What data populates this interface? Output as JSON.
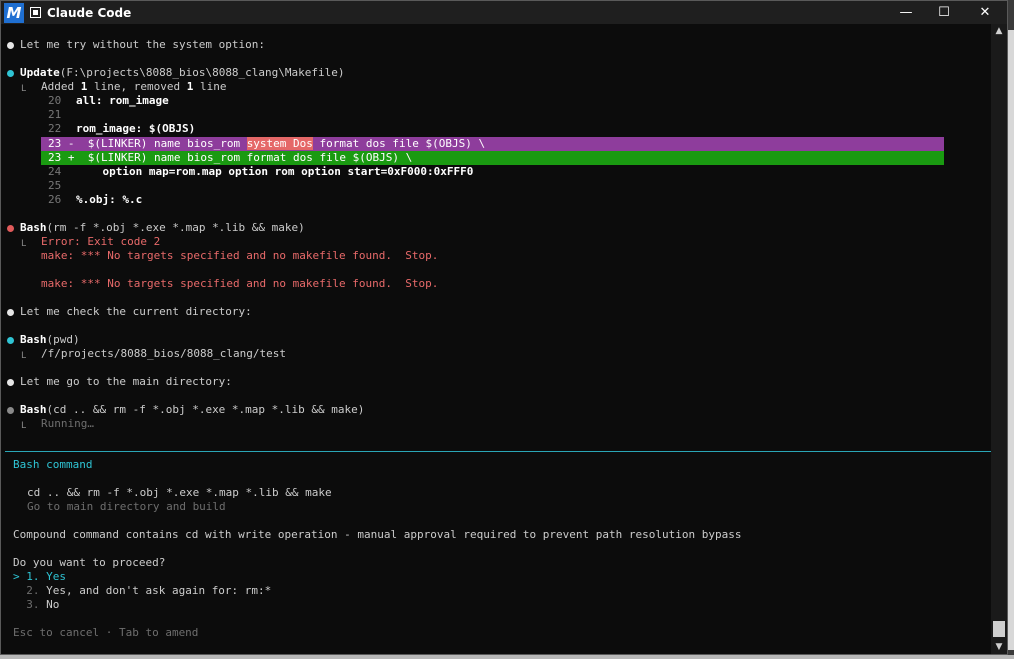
{
  "window": {
    "title": "Claude Code",
    "logo": "M",
    "app_icon": "m-logo-icon",
    "terminal_icon": "terminal-icon",
    "controls": {
      "minimize": "—",
      "maximize": "☐",
      "close": "✕"
    }
  },
  "colors": {
    "bullet_white": "#e6e6e6",
    "bullet_cyan": "#2fc4d4",
    "bullet_red": "#e05a5a",
    "diff_removed": "#8e3d9c",
    "diff_added": "#1a9a11",
    "error": "#e86a6a",
    "accent": "#2fc4d4"
  },
  "transcript": {
    "msg1": "Let me try without the system option:",
    "update": {
      "tool": "Update",
      "arg": "(F:\\projects\\8088_bios\\8088_clang\\Makefile)",
      "summary_pre": "Added ",
      "summary_n1": "1",
      "summary_mid": " line, removed ",
      "summary_n2": "1",
      "summary_post": " line",
      "lines": [
        {
          "num": "20",
          "code": "all: rom_image"
        },
        {
          "num": "21",
          "code": ""
        },
        {
          "num": "22",
          "code": "rom_image: $(OBJS)"
        }
      ],
      "removed": {
        "num": "23",
        "sign": "-",
        "pre": "  $(LINKER) name bios_rom ",
        "highlight": "system Dos",
        "post": " format dos file $(OBJS) \\"
      },
      "added": {
        "num": "23",
        "sign": "+",
        "text": "  $(LINKER) name bios_rom format dos file $(OBJS) \\"
      },
      "after": [
        {
          "num": "24",
          "code": "    option map=rom.map option rom option start=0xF000:0xFFF0"
        },
        {
          "num": "25",
          "code": ""
        },
        {
          "num": "26",
          "code": "%.obj: %.c"
        }
      ]
    },
    "bash1": {
      "tool": "Bash",
      "arg": "(rm -f *.obj *.exe *.map *.lib && make)",
      "error_title": "Error: Exit code 2",
      "error_line1": "make: *** No targets specified and no makefile found.  Stop.",
      "error_line2": "make: *** No targets specified and no makefile found.  Stop."
    },
    "msg2": "Let me check the current directory:",
    "bash2": {
      "tool": "Bash",
      "arg": "(pwd)",
      "output": "/f/projects/8088_bios/8088_clang/test"
    },
    "msg3": "Let me go to the main directory:",
    "bash3": {
      "tool": "Bash",
      "arg": "(cd .. && rm -f *.obj *.exe *.map *.lib && make)",
      "status": "Running…"
    },
    "elbow": "L"
  },
  "prompt": {
    "header": "Bash command",
    "command": "cd .. && rm -f *.obj *.exe *.map *.lib && make",
    "description": "Go to main directory and build",
    "warning": "Compound command contains cd with write operation - manual approval required to prevent path resolution bypass",
    "question": "Do you want to proceed?",
    "options": [
      {
        "prefix": "> 1. ",
        "label": "Yes",
        "selected": true
      },
      {
        "prefix": "  2. ",
        "label": "Yes, and don't ask again for: rm:*",
        "selected": false
      },
      {
        "prefix": "  3. ",
        "label": "No",
        "selected": false
      }
    ],
    "footer": "Esc to cancel · Tab to amend"
  },
  "scrollbar": {
    "up": "▲",
    "down": "▼"
  }
}
